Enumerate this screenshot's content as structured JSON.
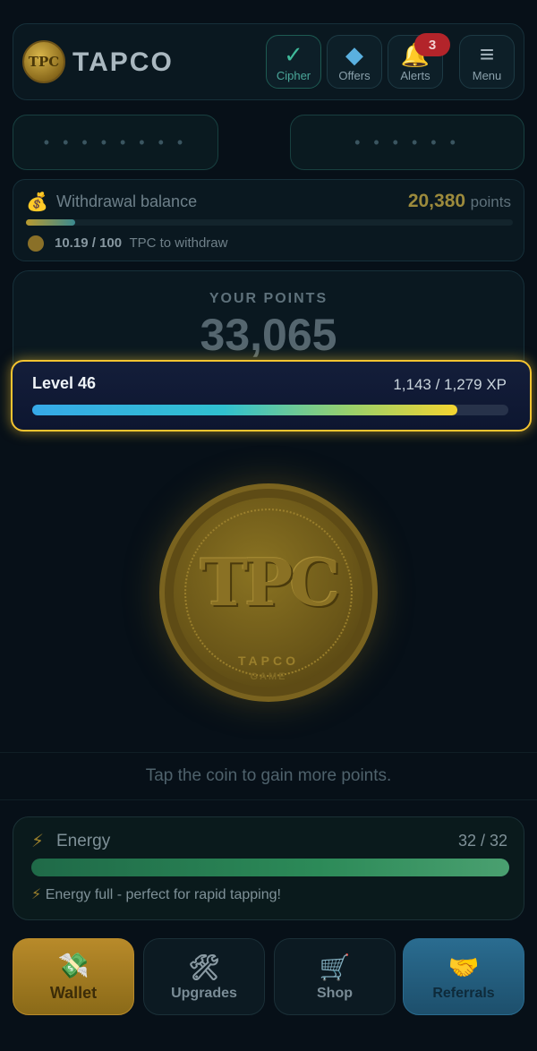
{
  "header": {
    "logo_text": "TPC",
    "brand": "TAPCO",
    "buttons": [
      {
        "label": "Cipher",
        "icon": "check-icon",
        "glyph": "✓"
      },
      {
        "label": "Offers",
        "icon": "diamond-icon",
        "glyph": "◆"
      },
      {
        "label": "Alerts",
        "icon": "bell-icon",
        "glyph": "🔔"
      },
      {
        "label": "Menu",
        "icon": "hamburger-icon",
        "glyph": "≡"
      }
    ],
    "alerts_badge": "3"
  },
  "placeholders": {
    "left": "• • • • • • • •",
    "right": "• • • • • •"
  },
  "withdrawal": {
    "label": "Withdrawal balance",
    "value": "20,380",
    "unit": "points",
    "progress_fraction": 0.1019,
    "current": "10.19",
    "target": "100",
    "sub_text": "TPC to withdraw"
  },
  "points": {
    "label": "YOUR POINTS",
    "value": "33,065"
  },
  "level": {
    "label": "Level 46",
    "xp_text": "1,143 / 1,279 XP",
    "progress_fraction": 0.8937
  },
  "coin": {
    "text": "TPC",
    "sub1": "TAPCO",
    "sub2": "GAME"
  },
  "hint": "Tap the coin to gain more points.",
  "energy": {
    "label": "Energy",
    "value": "32 / 32",
    "progress_fraction": 1.0,
    "message": "Energy full - perfect for rapid tapping!"
  },
  "nav": [
    {
      "label": "Wallet",
      "icon": "wallet-icon",
      "glyph": "💸"
    },
    {
      "label": "Upgrades",
      "icon": "tools-icon",
      "glyph": "🛠"
    },
    {
      "label": "Shop",
      "icon": "cart-icon",
      "glyph": "🛒"
    },
    {
      "label": "Referrals",
      "icon": "handshake-icon",
      "glyph": "🤝"
    }
  ],
  "colors": {
    "highlight": "#f4c430",
    "gold": "#b88a2a",
    "energy": "#2c8a58",
    "referrals": "#2a6c90"
  }
}
